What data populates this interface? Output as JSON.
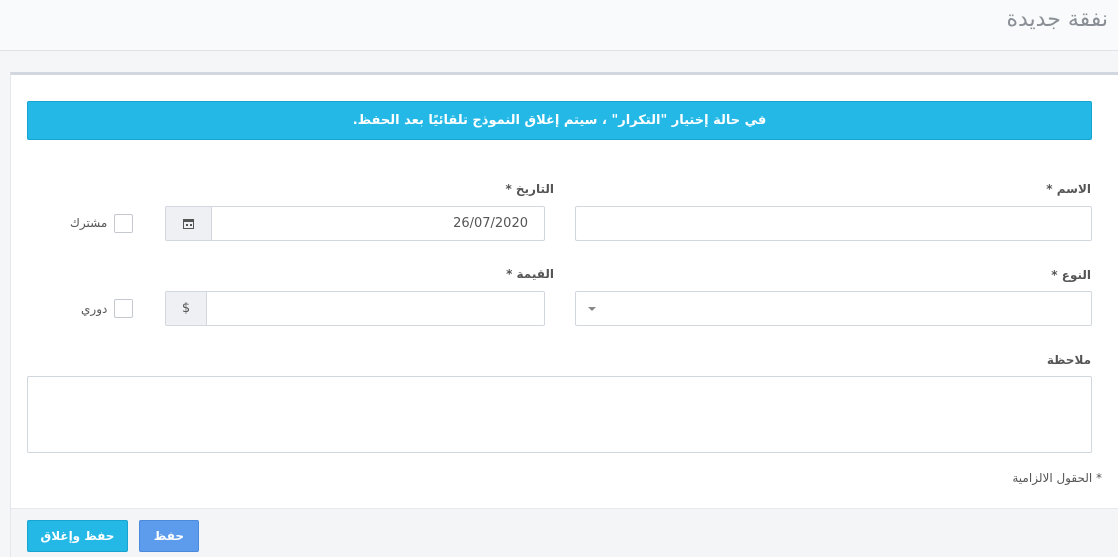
{
  "header": {
    "title": "نفقة جديدة"
  },
  "alert": {
    "text": "في حالة إختيار \"التكرار\" ، سيتم إغلاق النموذج تلقائيًا بعد الحفظ."
  },
  "form": {
    "name": {
      "label": "الاسم *",
      "value": ""
    },
    "date": {
      "label": "التاريخ *",
      "value": "26/07/2020",
      "addon_icon": "calendar-icon"
    },
    "shared": {
      "label": "مشترك",
      "checked": false
    },
    "type": {
      "label": "النوع *",
      "value": ""
    },
    "amount": {
      "label": "القيمة *",
      "value": "",
      "addon_text": "$"
    },
    "recurring": {
      "label": "دوري",
      "checked": false
    },
    "note": {
      "label": "ملاحظة",
      "value": ""
    },
    "required_note": "* الحقول الالزامية"
  },
  "footer": {
    "save_label": "حفظ",
    "save_close_label": "حفظ وإغلاق"
  },
  "colors": {
    "alert_bg": "#23b8e6",
    "save_button": "#5d9cec",
    "save_close_button": "#23b8e6"
  }
}
